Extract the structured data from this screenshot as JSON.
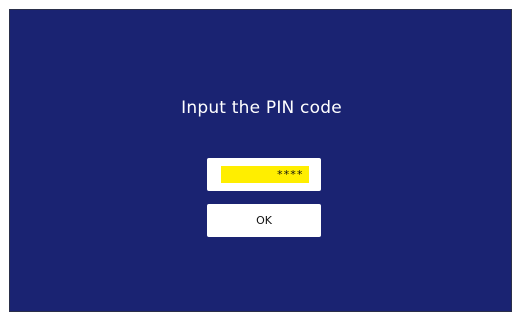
{
  "dialog": {
    "title": "Input the PIN code",
    "pin_value": "****",
    "ok_label": "OK"
  },
  "colors": {
    "background": "#1a2372",
    "pin_field": "#ffee00",
    "text_on_background": "#ffffff"
  }
}
